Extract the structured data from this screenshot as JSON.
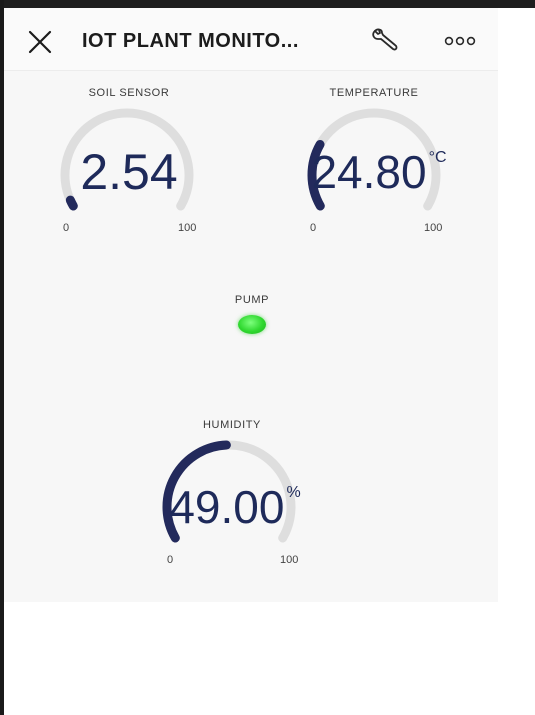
{
  "app": {
    "title": "IOT PLANT MONITO..."
  },
  "widgets": {
    "soil": {
      "title": "SOIL SENSOR",
      "value": "2.54",
      "unit": "",
      "min": "0",
      "max": "100",
      "level": 2.54
    },
    "temperature": {
      "title": "TEMPERATURE",
      "value": "24.80",
      "unit": "°C",
      "min": "0",
      "max": "100",
      "level": 24.8
    },
    "pump": {
      "title": "PUMP",
      "state": "on"
    },
    "humidity": {
      "title": "HUMIDITY",
      "value": "49.00",
      "unit": "%",
      "min": "0",
      "max": "100",
      "level": 49.0
    }
  },
  "colors": {
    "gauge_fill": "#232a5c",
    "gauge_track": "#dedede",
    "led_on": "#2fd82f"
  },
  "icons": {
    "close": "close-icon",
    "settings": "wrench-icon",
    "more": "more-dots-icon"
  }
}
